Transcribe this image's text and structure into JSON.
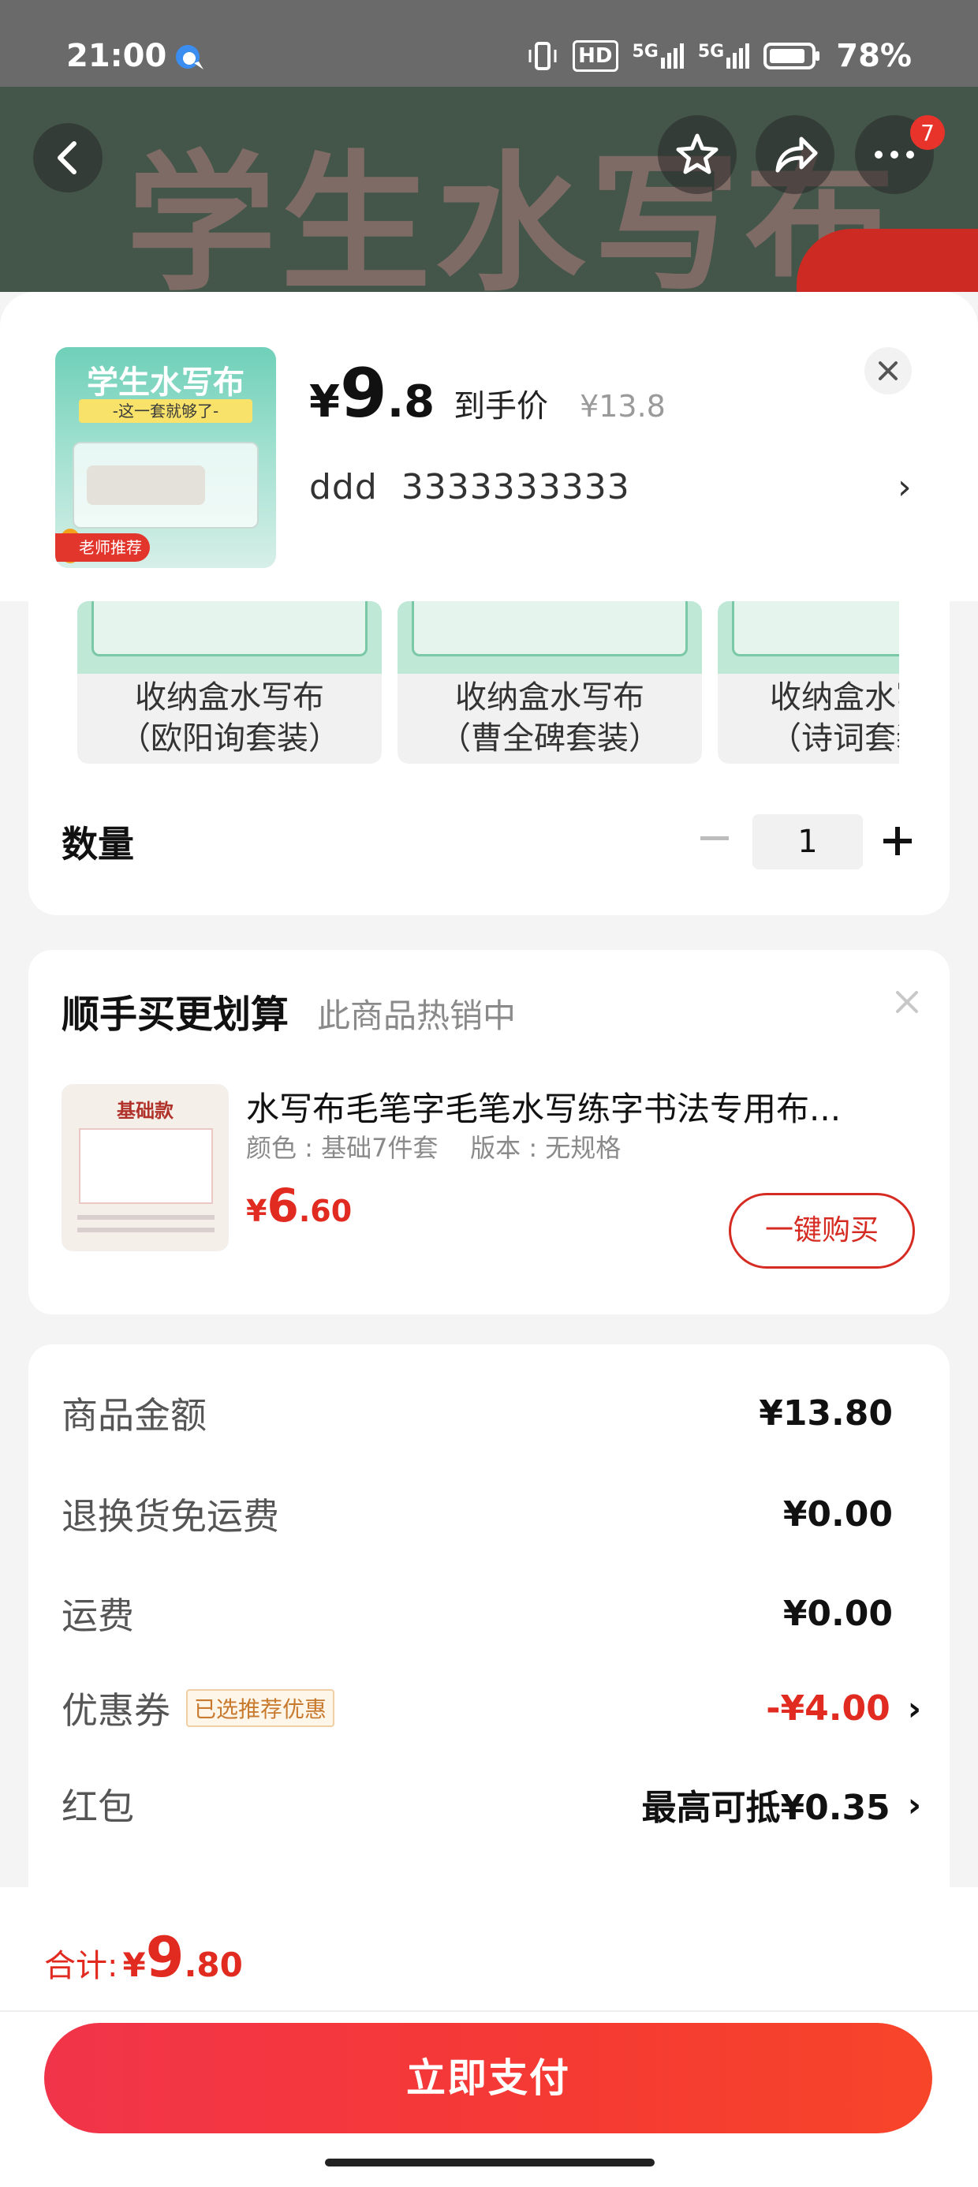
{
  "status_bar": {
    "time": "21:00",
    "network_hd": "HD",
    "network_5g_1": "5G",
    "network_5g_2": "5G",
    "battery": "78%"
  },
  "header": {
    "banner_text": "学生水写布",
    "notification_count": "7"
  },
  "product": {
    "thumb_title": "学生水写布",
    "thumb_subtitle": "-这一套就够了-",
    "thumb_tag": "老师推荐",
    "price_currency": "¥",
    "price_int": "9",
    "price_dec": ".8",
    "price_label": "到手价",
    "original_price": "¥13.8",
    "spec": "ddd  3333333333"
  },
  "variants": [
    {
      "line1": "收纳盒水写布",
      "line2": "（欧阳询套装）"
    },
    {
      "line1": "收纳盒水写布",
      "line2": "（曹全碑套装）"
    },
    {
      "line1": "收纳盒水写布",
      "line2": "（诗词套装）"
    }
  ],
  "quantity": {
    "label": "数量",
    "value": "1"
  },
  "upsell": {
    "title": "顺手买更划算",
    "subtitle": "此商品热销中",
    "thumb_title": "基础款",
    "item_name": "水写布毛笔字毛笔水写练字书法专用布...",
    "item_spec": "颜色 : 基础7件套    版本 : 无规格",
    "price_currency": "¥",
    "price_int": "6",
    "price_dec": ".60",
    "buy_label": "一键购买"
  },
  "summary": {
    "rows": [
      {
        "label": "商品金额",
        "value": "¥13.80"
      },
      {
        "label": "退换货免运费",
        "value": "¥0.00"
      },
      {
        "label": "运费",
        "value": "¥0.00"
      },
      {
        "label": "优惠券",
        "tag": "已选推荐优惠",
        "value": "-¥4.00"
      },
      {
        "label": "红包",
        "value": "最高可抵¥0.35"
      }
    ]
  },
  "footer": {
    "total_label": "合计:",
    "total_currency": "¥",
    "total_int": "9",
    "total_dec": ".80",
    "pay_label": "立即支付"
  },
  "colors": {
    "accent_red": "#e12a20",
    "pay_button": "#f53a33",
    "header_bg": "#44564a"
  }
}
